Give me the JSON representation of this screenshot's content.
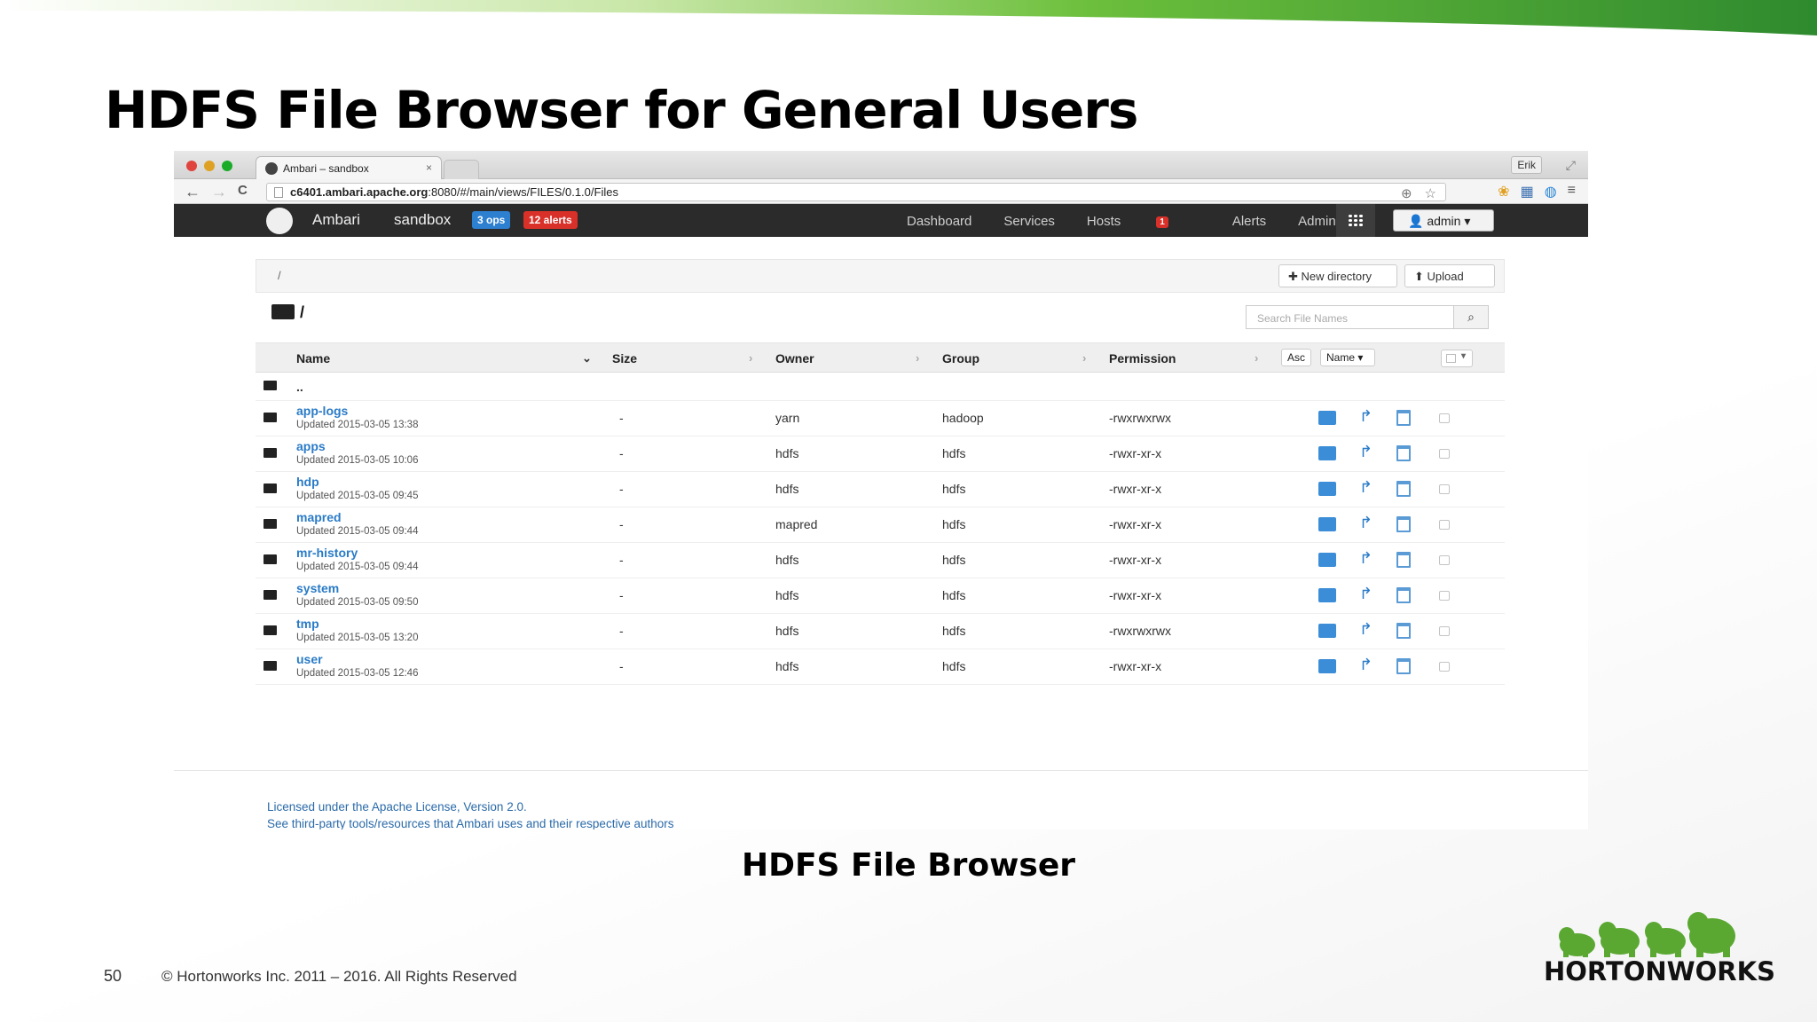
{
  "slide": {
    "title": "HDFS File Browser for General Users",
    "caption": "HDFS File Browser",
    "page_number": "50",
    "copyright": "© Hortonworks Inc. 2011 – 2016. All Rights Reserved",
    "logo_text": "HORTONWORKS",
    "brand_green": "#6cbf3c"
  },
  "browser": {
    "tab_title": "Ambari – sandbox",
    "tab_close": "×",
    "user": "Erik",
    "url_domain": "c6401.ambari.apache.org",
    "url_rest": ":8080/#/main/views/FILES/0.1.0/Files",
    "back": "←",
    "forward": "→",
    "reload": "C"
  },
  "ambari": {
    "brand": "Ambari",
    "cluster": "sandbox",
    "ops_badge": "3 ops",
    "alerts_badge": "12 alerts",
    "nav": {
      "dashboard": "Dashboard",
      "services": "Services",
      "hosts": "Hosts",
      "hosts_count": "1",
      "alerts": "Alerts",
      "admin": "Admin"
    },
    "admin_menu": "👤 admin ▾"
  },
  "files": {
    "breadcrumb": "/",
    "new_directory": "✚ New directory",
    "upload": "⬆ Upload",
    "current_path": "/",
    "search_placeholder": "Search File Names",
    "search_icon": "🔍",
    "columns": {
      "name": "Name",
      "size": "Size",
      "owner": "Owner",
      "group": "Group",
      "permission": "Permission"
    },
    "sort_order": "Asc",
    "sort_field": "Name ▾",
    "parent_dir": "..",
    "rows": [
      {
        "name": "app-logs",
        "updated": "Updated 2015-03-05 13:38",
        "size": "-",
        "owner": "yarn",
        "group": "hadoop",
        "permission": "-rwxrwxrwx"
      },
      {
        "name": "apps",
        "updated": "Updated 2015-03-05 10:06",
        "size": "-",
        "owner": "hdfs",
        "group": "hdfs",
        "permission": "-rwxr-xr-x"
      },
      {
        "name": "hdp",
        "updated": "Updated 2015-03-05 09:45",
        "size": "-",
        "owner": "hdfs",
        "group": "hdfs",
        "permission": "-rwxr-xr-x"
      },
      {
        "name": "mapred",
        "updated": "Updated 2015-03-05 09:44",
        "size": "-",
        "owner": "mapred",
        "group": "hdfs",
        "permission": "-rwxr-xr-x"
      },
      {
        "name": "mr-history",
        "updated": "Updated 2015-03-05 09:44",
        "size": "-",
        "owner": "hdfs",
        "group": "hdfs",
        "permission": "-rwxr-xr-x"
      },
      {
        "name": "system",
        "updated": "Updated 2015-03-05 09:50",
        "size": "-",
        "owner": "hdfs",
        "group": "hdfs",
        "permission": "-rwxr-xr-x"
      },
      {
        "name": "tmp",
        "updated": "Updated 2015-03-05 13:20",
        "size": "-",
        "owner": "hdfs",
        "group": "hdfs",
        "permission": "-rwxrwxrwx"
      },
      {
        "name": "user",
        "updated": "Updated 2015-03-05 12:46",
        "size": "-",
        "owner": "hdfs",
        "group": "hdfs",
        "permission": "-rwxr-xr-x"
      }
    ],
    "row_actions": {
      "rename_icon": "↱"
    }
  },
  "footer": {
    "license_line1": "Licensed under the Apache License, Version 2.0.",
    "license_line2": "See third-party tools/resources that Ambari uses and their respective authors"
  }
}
